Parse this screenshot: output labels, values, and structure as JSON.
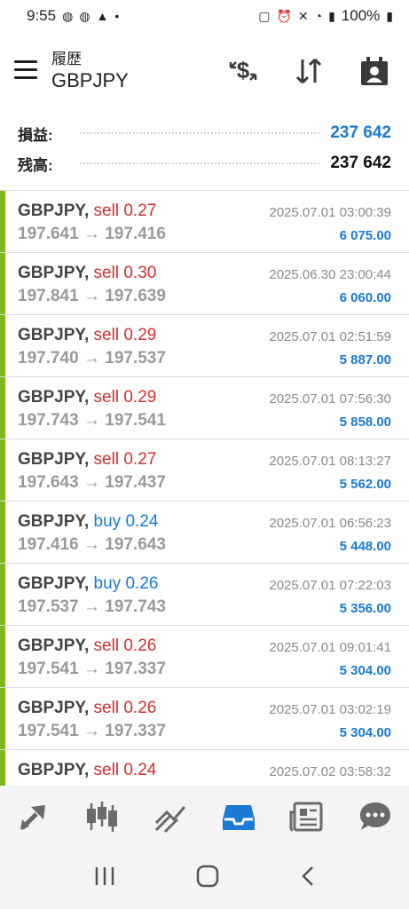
{
  "status": {
    "time": "9:55",
    "battery": "100%"
  },
  "header": {
    "subtitle": "履歴",
    "title": "GBPJPY"
  },
  "summary": {
    "profit_label": "損益:",
    "profit_value": "237 642",
    "balance_label": "残高:",
    "balance_value": "237 642"
  },
  "deals": [
    {
      "symbol": "GBPJPY,",
      "side": "sell",
      "volume": "0.27",
      "open": "197.641",
      "close": "197.416",
      "arrow": "→",
      "time": "2025.07.01 03:00:39",
      "profit": "6 075.00"
    },
    {
      "symbol": "GBPJPY,",
      "side": "sell",
      "volume": "0.30",
      "open": "197.841",
      "close": "197.639",
      "arrow": "→",
      "time": "2025.06.30 23:00:44",
      "profit": "6 060.00"
    },
    {
      "symbol": "GBPJPY,",
      "side": "sell",
      "volume": "0.29",
      "open": "197.740",
      "close": "197.537",
      "arrow": "→",
      "time": "2025.07.01 02:51:59",
      "profit": "5 887.00"
    },
    {
      "symbol": "GBPJPY,",
      "side": "sell",
      "volume": "0.29",
      "open": "197.743",
      "close": "197.541",
      "arrow": "→",
      "time": "2025.07.01 07:56:30",
      "profit": "5 858.00"
    },
    {
      "symbol": "GBPJPY,",
      "side": "sell",
      "volume": "0.27",
      "open": "197.643",
      "close": "197.437",
      "arrow": "→",
      "time": "2025.07.01 08:13:27",
      "profit": "5 562.00"
    },
    {
      "symbol": "GBPJPY,",
      "side": "buy",
      "volume": "0.24",
      "open": "197.416",
      "close": "197.643",
      "arrow": "→",
      "time": "2025.07.01 06:56:23",
      "profit": "5 448.00"
    },
    {
      "symbol": "GBPJPY,",
      "side": "buy",
      "volume": "0.26",
      "open": "197.537",
      "close": "197.743",
      "arrow": "→",
      "time": "2025.07.01 07:22:03",
      "profit": "5 356.00"
    },
    {
      "symbol": "GBPJPY,",
      "side": "sell",
      "volume": "0.26",
      "open": "197.541",
      "close": "197.337",
      "arrow": "→",
      "time": "2025.07.01 09:01:41",
      "profit": "5 304.00"
    },
    {
      "symbol": "GBPJPY,",
      "side": "sell",
      "volume": "0.26",
      "open": "197.541",
      "close": "197.337",
      "arrow": "→",
      "time": "2025.07.01 03:02:19",
      "profit": "5 304.00"
    },
    {
      "symbol": "GBPJPY,",
      "side": "sell",
      "volume": "0.24",
      "open": "",
      "close": "",
      "arrow": "",
      "time": "2025.07.02 03:58:32",
      "profit": ""
    }
  ],
  "colors": {
    "accent": "#1a7ad4",
    "sell": "#d32f2f",
    "buy": "#1a7ad4",
    "row_bar": "#7cb818",
    "active_nav": "#1a7ad4"
  },
  "nav_icons": [
    "trade-icon",
    "quotes-icon",
    "chart-icon",
    "history-icon",
    "news-icon",
    "chat-icon"
  ]
}
